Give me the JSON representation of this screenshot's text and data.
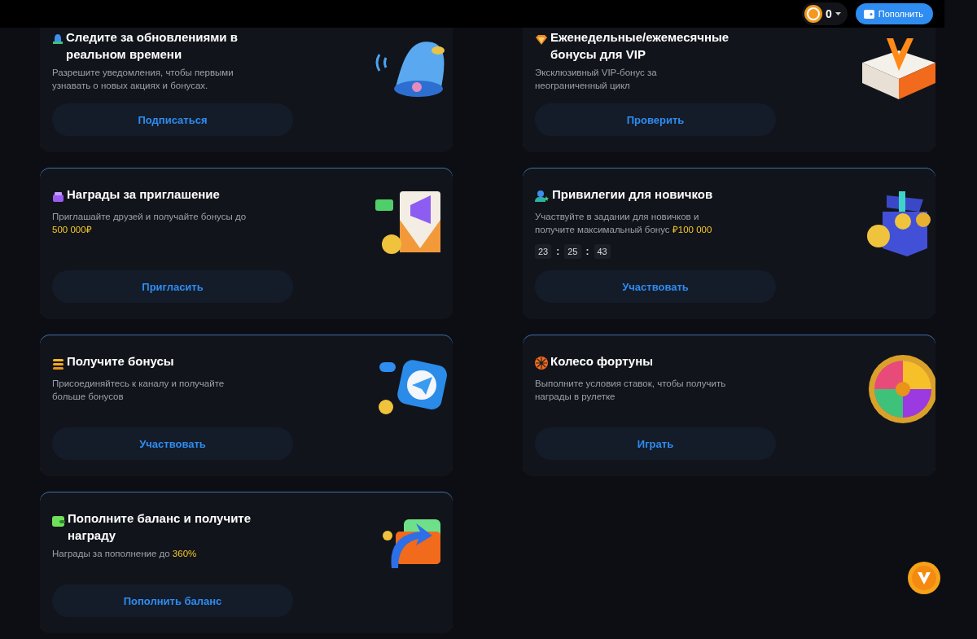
{
  "top_bar": {
    "balance": "0",
    "deposit_button": "Пополнить"
  },
  "cards": [
    {
      "title": "Следите за обновлениями в реальном времени",
      "description": "Разрешите уведомления, чтобы первыми узнавать о новых акциях и бонусах.",
      "button": "Подписаться"
    },
    {
      "title": "Еженедельные/ежемесячные бонусы для VIP",
      "description": "Эксклюзивный VIP-бонус за неограниченный цикл",
      "button": "Проверить"
    },
    {
      "title": "Награды за приглашение",
      "description": "Приглашайте друзей и получайте бонусы до",
      "highlight": "500 000₽",
      "button": "Пригласить"
    },
    {
      "title": "Привилегии для новичков",
      "description": "Участвуйте в задании для новичков и получите максимальный бонус",
      "highlight": "₽100 000",
      "timer": [
        {
          "kind": "digits",
          "text": "23"
        },
        {
          "kind": "separator",
          "text": ":"
        },
        {
          "kind": "digits",
          "text": "25"
        },
        {
          "kind": "separator",
          "text": ":"
        },
        {
          "kind": "digits",
          "text": "43"
        }
      ],
      "button": "Участвовать"
    },
    {
      "title": "Получите бонусы",
      "description": "Присоединяйтесь к каналу и получайте больше бонусов",
      "button": "Участвовать"
    },
    {
      "title": "Колесо фортуны",
      "description": "Выполните условия ставок, чтобы получить награды в рулетке",
      "button": "Играть"
    },
    {
      "title": "Пополните баланс и получите награду",
      "description": "Награды за пополнение до",
      "highlight": "360%",
      "button": "Пополнить баланс"
    }
  ]
}
